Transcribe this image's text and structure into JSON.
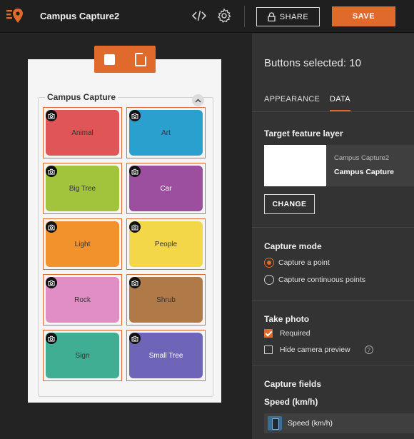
{
  "header": {
    "title": "Campus Capture2",
    "share_label": "SHARE",
    "save_label": "SAVE"
  },
  "preview": {
    "group_title": "Campus Capture",
    "buttons": [
      {
        "label": "Animal",
        "color": "#e05656"
      },
      {
        "label": "Art",
        "color": "#2aa0cf"
      },
      {
        "label": "Big Tree",
        "color": "#a2c43c"
      },
      {
        "label": "Car",
        "color": "#9c4f9e"
      },
      {
        "label": "Light",
        "color": "#f2922d"
      },
      {
        "label": "People",
        "color": "#f3d748"
      },
      {
        "label": "Rock",
        "color": "#e08ec4"
      },
      {
        "label": "Shrub",
        "color": "#b07a48"
      },
      {
        "label": "Sign",
        "color": "#3fae92"
      },
      {
        "label": "Small Tree",
        "color": "#6f65b8"
      }
    ]
  },
  "panel": {
    "selected_text": "Buttons selected: 10",
    "tabs": [
      "APPEARANCE",
      "DATA"
    ],
    "active_tab": "DATA",
    "target_layer_heading": "Target feature layer",
    "layer_sub": "Campus Capture2",
    "layer_name": "Campus Capture",
    "change_label": "CHANGE",
    "capture_mode_heading": "Capture mode",
    "capture_modes": [
      "Capture a point",
      "Capture continuous points"
    ],
    "selected_capture_mode": "Capture a point",
    "take_photo_heading": "Take photo",
    "required_label": "Required",
    "required_checked": true,
    "hide_preview_label": "Hide camera preview",
    "hide_preview_checked": false,
    "capture_fields_heading": "Capture fields",
    "speed_heading": "Speed (km/h)",
    "speed_field_label": "Speed (km/h)"
  },
  "colors": {
    "accent": "#e06a2c"
  }
}
